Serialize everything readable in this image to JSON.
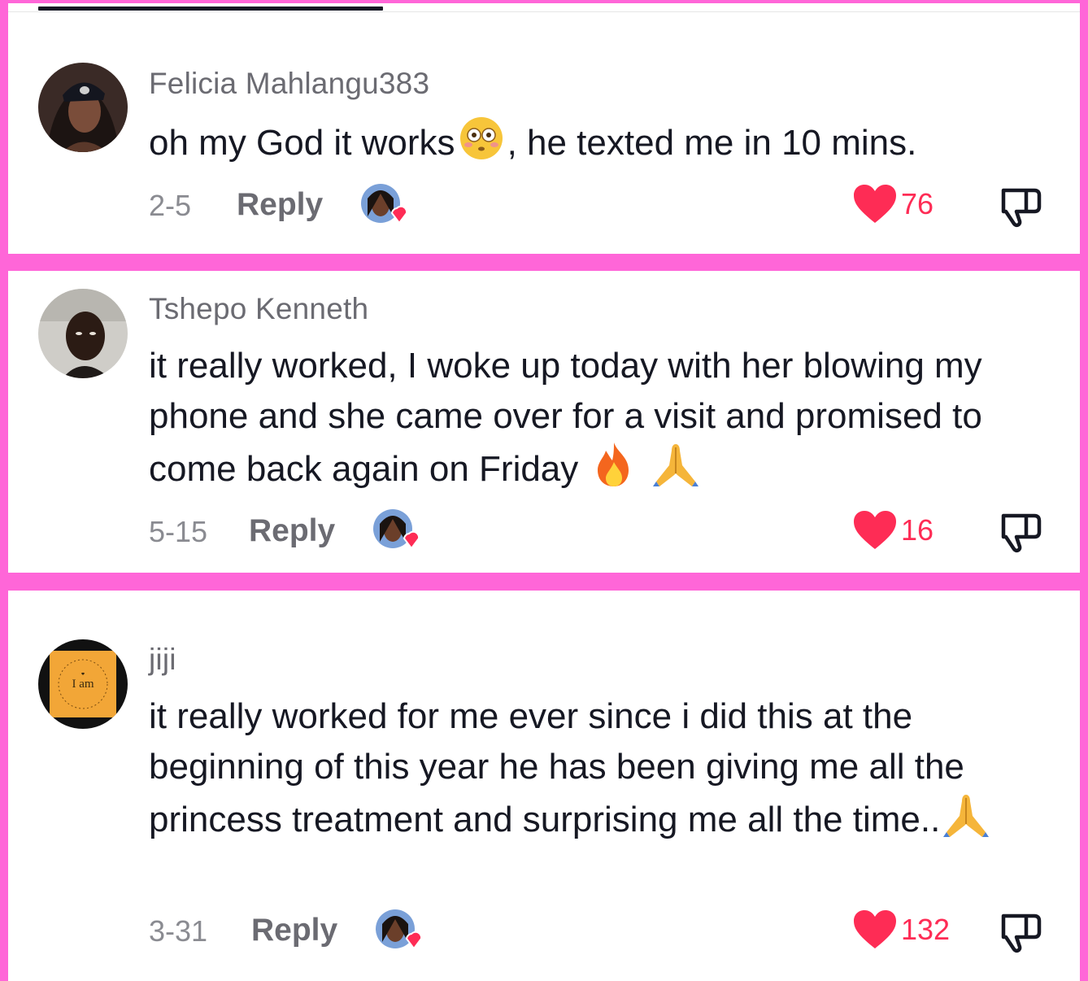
{
  "comments": [
    {
      "username": "Felicia Mahlangu383",
      "text_before": "oh my God it works",
      "emoji_mid": "flushed-face",
      "text_after": ", he texted me in 10 mins.",
      "date": "2-5",
      "reply_label": "Reply",
      "likes": "76"
    },
    {
      "username": "Tshepo Kenneth",
      "text": "it really worked, I woke up today with her blowing my phone and she came over for a visit and promised to come back again on Friday",
      "emojis": [
        "fire",
        "folded-hands"
      ],
      "date": "5-15",
      "reply_label": "Reply",
      "likes": "16"
    },
    {
      "username": "jiji",
      "text": "it really worked for me ever since i did this at the beginning of this year he has been giving me all the princess treatment and surprising me all the time..",
      "emojis": [
        "folded-hands"
      ],
      "date": "3-31",
      "reply_label": "Reply",
      "likes": "132",
      "avatar_text": "I am"
    }
  ],
  "colors": {
    "frame": "#ff66d8",
    "like": "#fe2c55",
    "username": "#6b6b72",
    "text": "#161823"
  }
}
